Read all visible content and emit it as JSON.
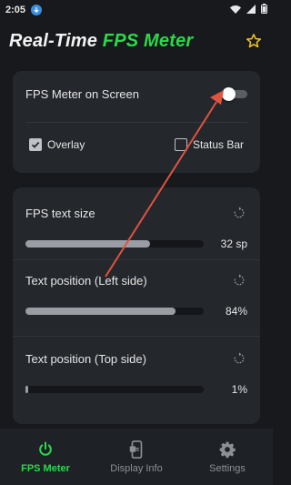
{
  "status_bar": {
    "time": "2:05"
  },
  "header": {
    "title_main": "Real-Time",
    "title_accent": "FPS Meter",
    "accent_color": "#2bd94a"
  },
  "overlay_card": {
    "switch_label": "FPS Meter on Screen",
    "switch_on": false,
    "checks": [
      {
        "label": "Overlay",
        "checked": true
      },
      {
        "label": "Status Bar",
        "checked": false
      }
    ]
  },
  "settings": [
    {
      "label": "FPS text size",
      "value": "32 sp",
      "fill": 0.7
    },
    {
      "label": "Text position (Left side)",
      "value": "84%",
      "fill": 0.84
    },
    {
      "label": "Text position (Top side)",
      "value": "1%",
      "fill": 0.01
    }
  ],
  "nav": {
    "items": [
      {
        "label": "FPS Meter",
        "icon": "power-icon",
        "active": true
      },
      {
        "label": "Display Info",
        "icon": "phone-info-icon",
        "active": false
      },
      {
        "label": "Settings",
        "icon": "gear-icon",
        "active": false
      }
    ]
  },
  "annotation": {
    "color": "#e0533f"
  }
}
